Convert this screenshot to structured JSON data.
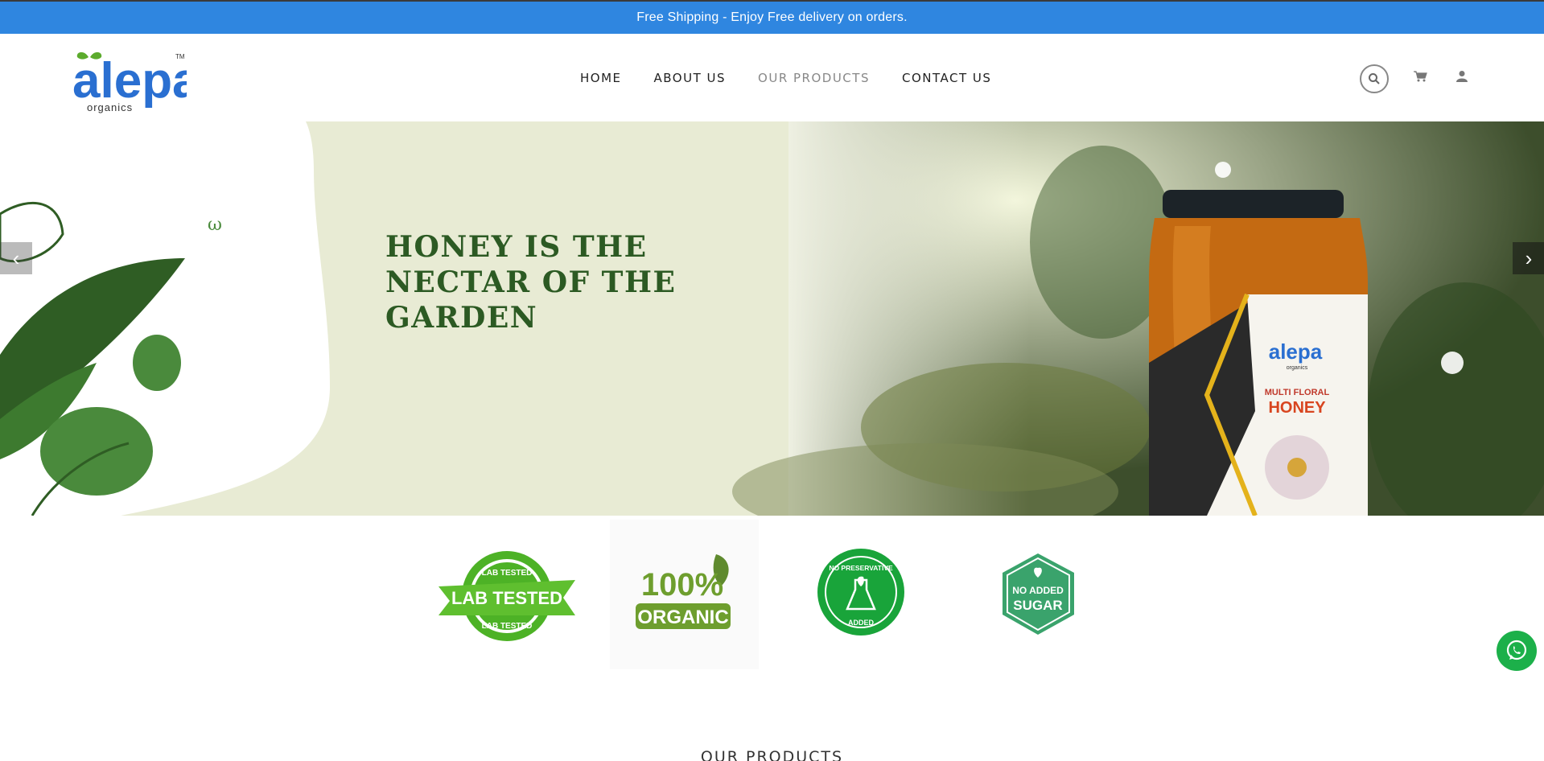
{
  "announcement": {
    "text": "Free Shipping - Enjoy Free delivery on orders."
  },
  "brand": {
    "logo_text": "alepa",
    "logo_sub": "organics",
    "trademark": "TM"
  },
  "nav": {
    "items": [
      {
        "label": "HOME",
        "active": false
      },
      {
        "label": "ABOUT US",
        "active": false
      },
      {
        "label": "OUR PRODUCTS",
        "active": true
      },
      {
        "label": "CONTACT US",
        "active": false
      }
    ]
  },
  "header_icons": {
    "search": "search-icon",
    "cart": "cart-icon",
    "account": "user-icon"
  },
  "hero": {
    "title_lines": [
      "HONEY IS THE",
      "NECTAR OF THE",
      "GARDEN"
    ],
    "product_brand": "alepa",
    "product_brand_sub": "organics",
    "product_line1": "MULTI FLORAL",
    "product_line2": "HONEY",
    "prev_arrow": "‹",
    "next_arrow": "›"
  },
  "badges": {
    "lab_tested": {
      "top": "LAB TESTED",
      "main": "LAB TESTED",
      "bottom": "LAB TESTED"
    },
    "organic": {
      "main": "100%",
      "sub": "ORGANIC"
    },
    "no_preservative": {
      "top": "NO PRESERVATIVE",
      "bottom": "ADDED"
    },
    "no_sugar": {
      "top": "NO ADDED",
      "main": "SUGAR"
    }
  },
  "section": {
    "title": "OUR PRODUCTS"
  },
  "colors": {
    "topbar": "#2f86e0",
    "accent_green": "#2c5a23",
    "badge_green": "#4db226",
    "whatsapp": "#1cb04a"
  }
}
